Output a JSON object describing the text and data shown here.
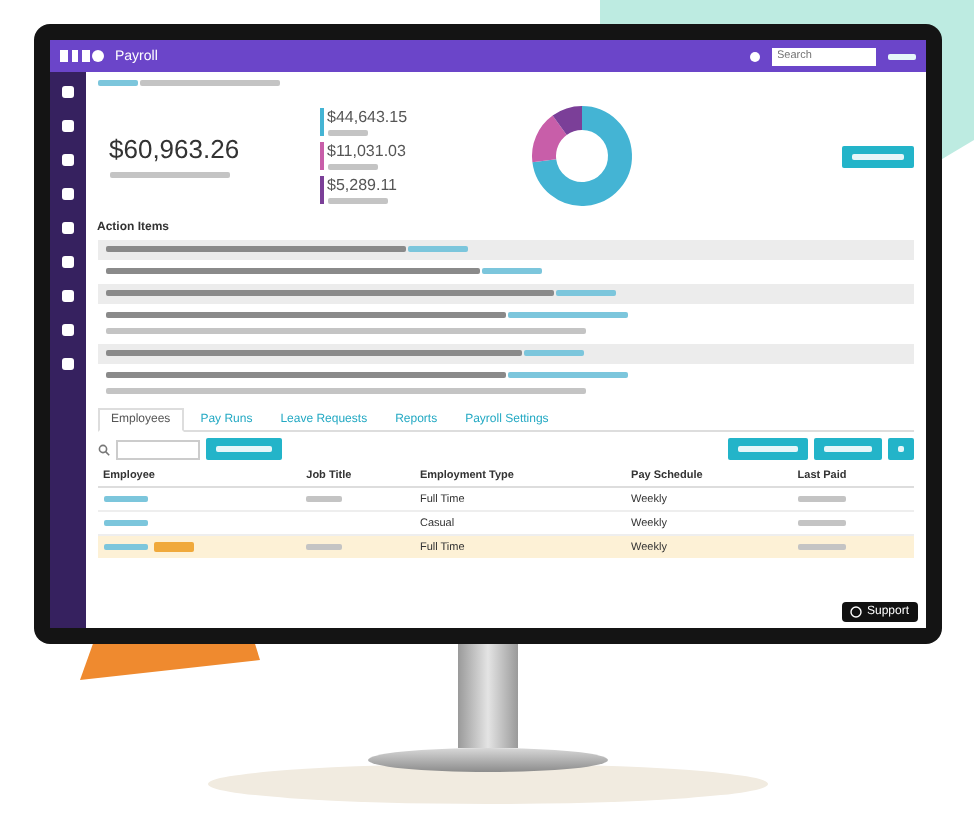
{
  "header": {
    "title": "Payroll",
    "search": {
      "placeholder": "Search"
    }
  },
  "summary": {
    "total": "$60,963.26",
    "items": [
      {
        "amount": "$44,643.15",
        "color": "#44b4d4"
      },
      {
        "amount": "$11,031.03",
        "color": "#c85ea9"
      },
      {
        "amount": "$5,289.11",
        "color": "#7b3f98"
      }
    ]
  },
  "action_items": {
    "title": "Action Items",
    "rows": [
      {
        "kind": "single"
      },
      {
        "kind": "single"
      },
      {
        "kind": "single"
      },
      {
        "kind": "double"
      },
      {
        "kind": "single"
      },
      {
        "kind": "double"
      }
    ]
  },
  "tabs": [
    {
      "label": "Employees",
      "selected": true
    },
    {
      "label": "Pay Runs",
      "selected": false
    },
    {
      "label": "Leave Requests",
      "selected": false
    },
    {
      "label": "Reports",
      "selected": false
    },
    {
      "label": "Payroll Settings",
      "selected": false
    }
  ],
  "table": {
    "columns": [
      "Employee",
      "Job Title",
      "Employment Type",
      "Pay Schedule",
      "Last Paid"
    ],
    "rows": [
      {
        "employment_type": "Full Time",
        "pay_schedule": "Weekly",
        "selected": false,
        "badge": false
      },
      {
        "employment_type": "Casual",
        "pay_schedule": "Weekly",
        "selected": false,
        "badge": false
      },
      {
        "employment_type": "Full Time",
        "pay_schedule": "Weekly",
        "selected": true,
        "badge": true
      }
    ]
  },
  "support_button": "Support"
}
